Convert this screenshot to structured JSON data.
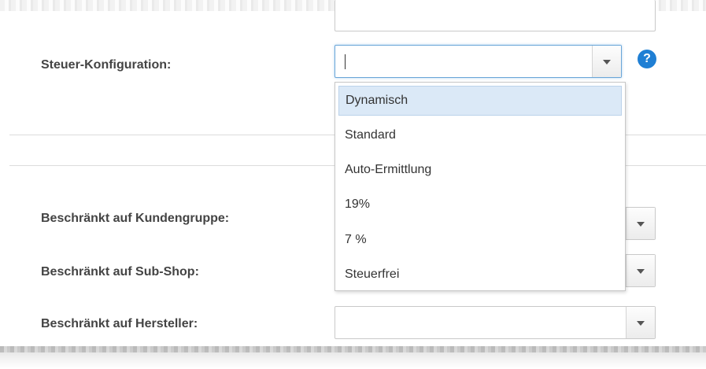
{
  "fields": {
    "tax_config": {
      "label": "Steuer-Konfiguration:",
      "value": ""
    },
    "customer_group": {
      "label": "Beschränkt auf Kundengruppe:"
    },
    "sub_shop": {
      "label": "Beschränkt auf Sub-Shop:"
    },
    "manufacturer": {
      "label": "Beschränkt auf Hersteller:"
    }
  },
  "help": {
    "glyph": "?"
  },
  "dropdown": {
    "options": [
      "Dynamisch",
      "Standard",
      "Auto-Ermittlung",
      "19%",
      "7 %",
      "Steuerfrei"
    ],
    "highlighted_index": 0
  },
  "colors": {
    "accent": "#1f7fd4",
    "focus_border": "#6aa6d8",
    "highlight": "#dbe9f7"
  }
}
